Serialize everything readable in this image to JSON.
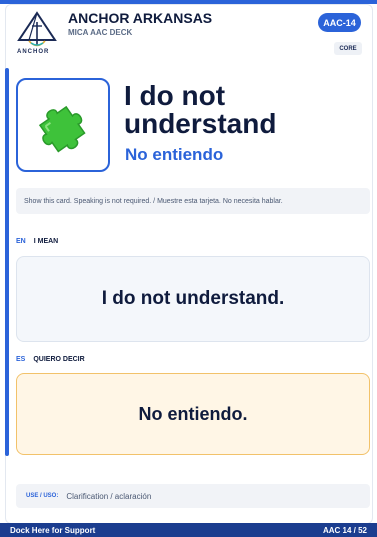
{
  "header": {
    "logo_text": "ANCHOR",
    "brand": "ANCHOR ARKANSAS",
    "deck": "MICA AAC DECK",
    "card_code": "AAC-14",
    "category": "CORE"
  },
  "card": {
    "symbol_icon": "puzzle-piece-icon",
    "phrase_en": "I do not understand",
    "phrase_es": "No entiendo",
    "note": "Show this card. Speaking is not required. / Muestre esta tarjeta. No necesita hablar."
  },
  "english": {
    "code": "EN",
    "label": "I MEAN",
    "text": "I do not understand."
  },
  "spanish": {
    "code": "ES",
    "label": "QUIERO DECIR",
    "text": "No entiendo."
  },
  "use": {
    "label": "USE / USO:",
    "value": "Clarification / aclaración"
  },
  "footer": {
    "left": "Dock Here for Support",
    "right": "AAC 14 / 52"
  },
  "colors": {
    "accent": "#2b63d9",
    "ink": "#0f1b3d",
    "spanish_bg": "#fff6e6",
    "puzzle": "#3ec23a"
  }
}
